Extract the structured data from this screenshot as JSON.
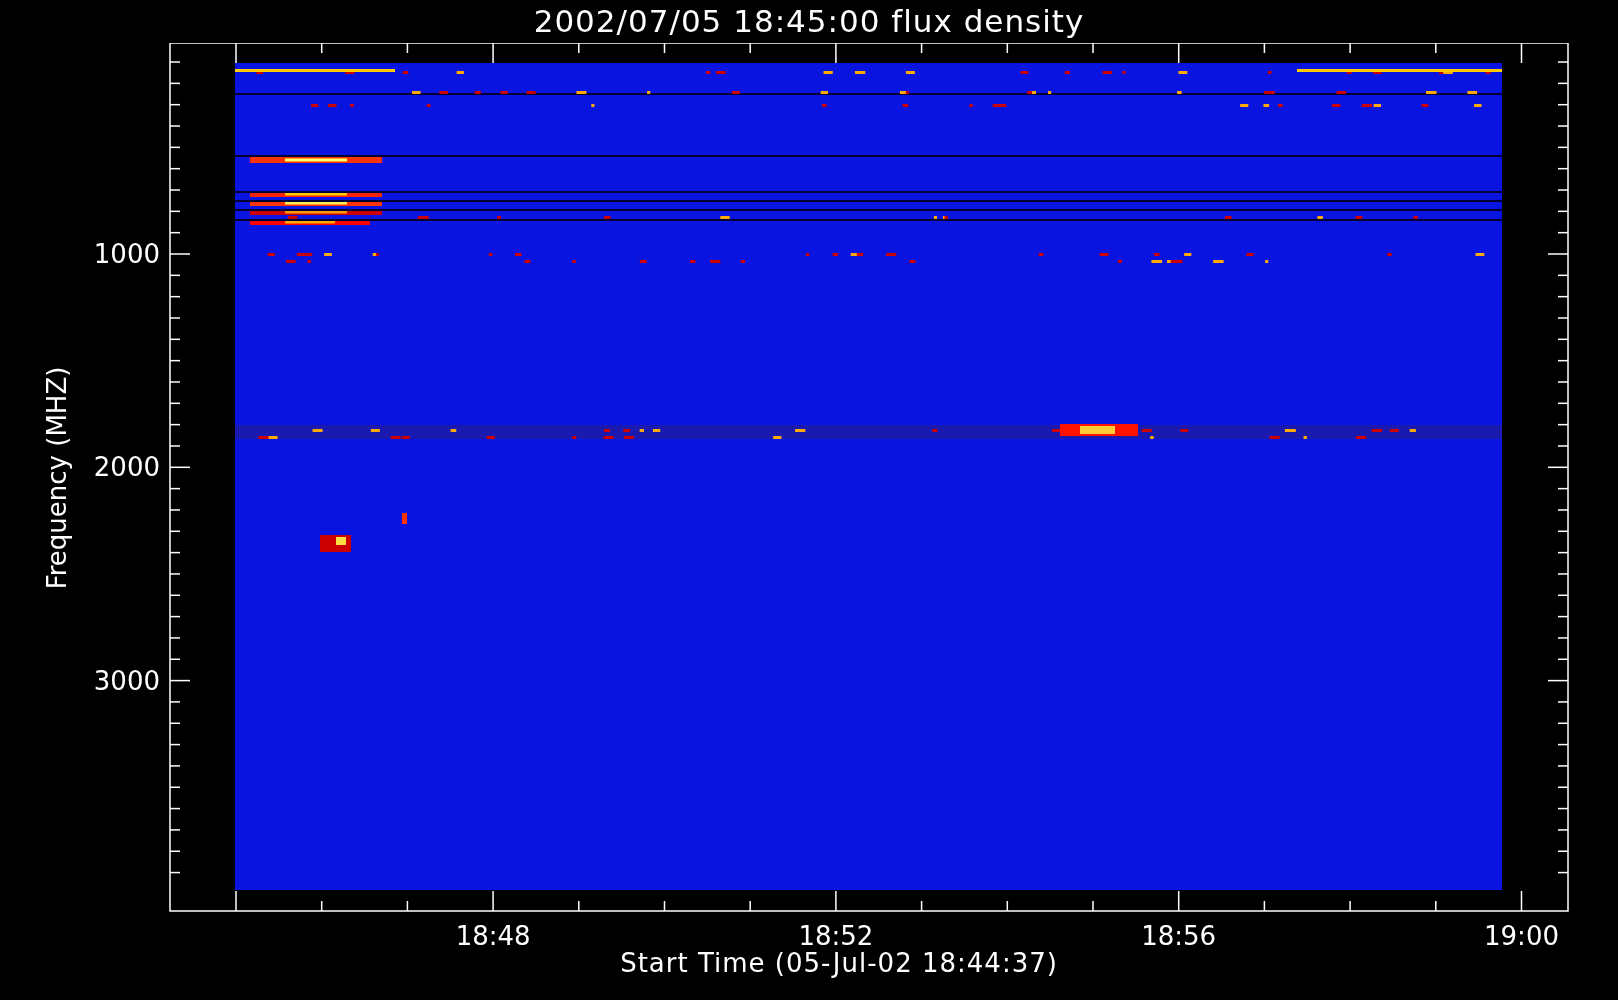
{
  "title": "2002/07/05 18:45:00 flux density",
  "plot": {
    "xlabel": "Start Time (05-Jul-02 18:44:37)",
    "ylabel": "Frequency (MHZ)",
    "xticks": [
      "18:48",
      "18:52",
      "18:56",
      "19:00"
    ],
    "yticks": [
      "1000",
      "2000",
      "3000"
    ],
    "picture": {
      "kind": "spectrogram"
    }
  }
}
